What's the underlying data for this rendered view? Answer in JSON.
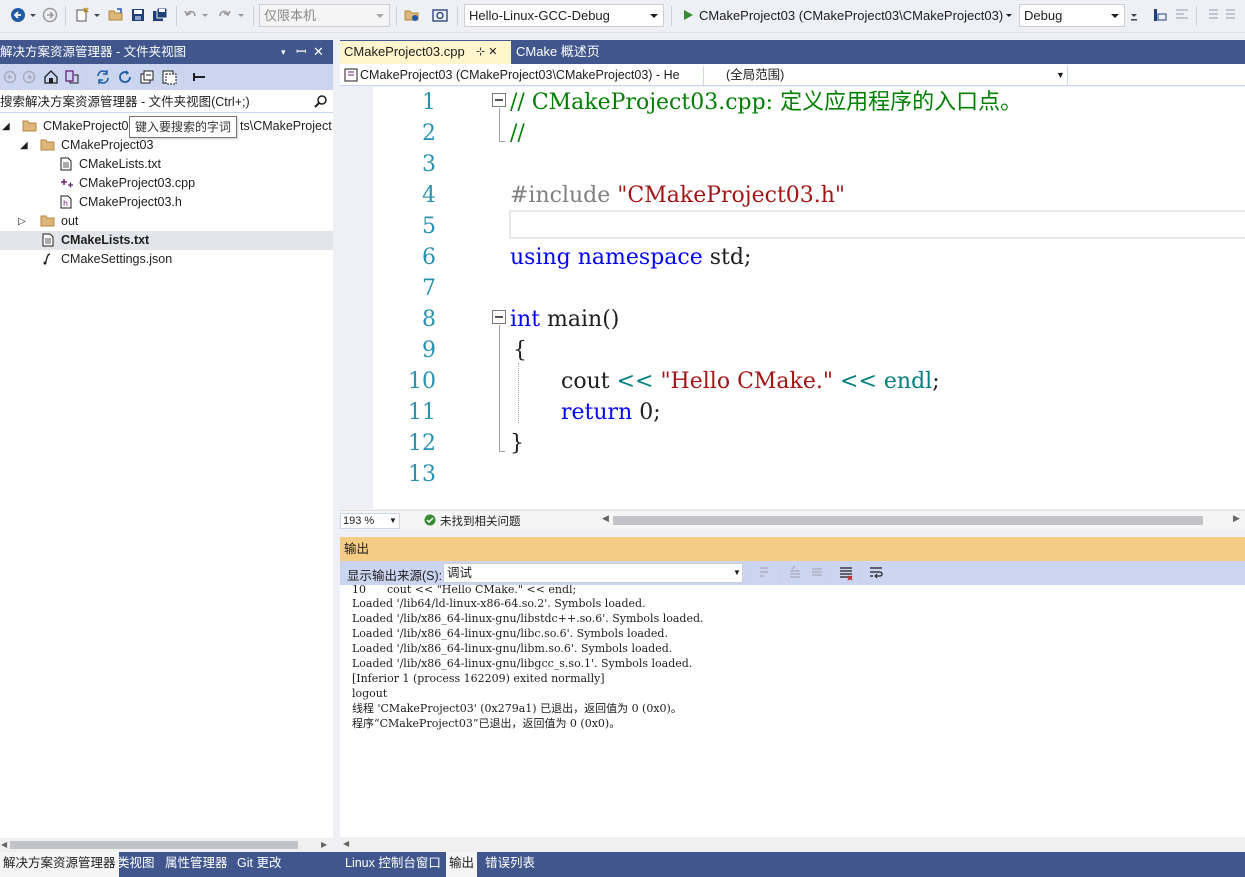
{
  "toolbar": {
    "platform": "仅限本机",
    "config_target": "Hello-Linux-GCC-Debug",
    "startup_item": "CMakeProject03 (CMakeProject03\\CMakeProject03)",
    "build_config": "Debug"
  },
  "left_panel": {
    "title": "解决方案资源管理器 - 文件夹视图",
    "search_placeholder": "搜索解决方案资源管理器 - 文件夹视图(Ctrl+;)",
    "tooltip": "键入要搜索的字词",
    "tree": {
      "root": "CMakeProject0",
      "root_tail": "ts\\CMakeProject",
      "folder": "CMakeProject03",
      "files": [
        "CMakeLists.txt",
        "CMakeProject03.cpp",
        "CMakeProject03.h"
      ],
      "out": "out",
      "root_files": [
        "CMakeLists.txt",
        "CMakeSettings.json"
      ]
    }
  },
  "bottom_tabs": {
    "left": [
      "解决方案资源管理器",
      "类视图",
      "属性管理器",
      "Git 更改"
    ],
    "right": [
      "Linux 控制台窗口",
      "输出",
      "错误列表"
    ]
  },
  "editor": {
    "tabs": [
      "CMakeProject03.cpp",
      "CMake 概述页"
    ],
    "tab_pin": "⊹ ✕",
    "nav_project": "CMakeProject03 (CMakeProject03\\CMakeProject03) - He",
    "nav_scope": "(全局范围)",
    "line_numbers": [
      "1",
      "2",
      "3",
      "4",
      "5",
      "6",
      "7",
      "8",
      "9",
      "10",
      "11",
      "12",
      "13"
    ],
    "code": {
      "l1": "// CMakeProject03.cpp: 定义应用程序的入口点。",
      "l2": "//",
      "l4_pp": "#include ",
      "l4_str": "\"CMakeProject03.h\"",
      "l6_kw1": "using",
      "l6_kw2": "namespace",
      "l6_rest": " std;",
      "l8_kw": "int",
      "l8_rest": " main()",
      "l9": "{",
      "l10_a": "cout",
      "l10_op1": " << ",
      "l10_str": "\"Hello CMake.\"",
      "l10_op2": " << ",
      "l10_b": "endl",
      "l10_c": ";",
      "l11_kw": "return",
      "l11_rest": " 0;",
      "l12": "}"
    },
    "zoom": "193 %",
    "issues": "未找到相关问题"
  },
  "output": {
    "title": "输出",
    "source_label": "显示输出来源(S):",
    "source_value": "调试",
    "lines": [
      "10      cout << \"Hello CMake.\" << endl;",
      "Loaded '/lib64/ld-linux-x86-64.so.2'. Symbols loaded.",
      "Loaded '/lib/x86_64-linux-gnu/libstdc++.so.6'. Symbols loaded.",
      "Loaded '/lib/x86_64-linux-gnu/libc.so.6'. Symbols loaded.",
      "Loaded '/lib/x86_64-linux-gnu/libm.so.6'. Symbols loaded.",
      "Loaded '/lib/x86_64-linux-gnu/libgcc_s.so.1'. Symbols loaded.",
      "[Inferior 1 (process 162209) exited normally]",
      "logout",
      "线程 'CMakeProject03' (0x279a1) 已退出，返回值为 0 (0x0)。",
      "程序“CMakeProject03”已退出，返回值为 0 (0x0)。"
    ]
  },
  "colors": {
    "title_bar": "#40568d",
    "output_title": "#f5cc84",
    "keyword": "#0000ff",
    "comment": "#008000",
    "string": "#a31515",
    "line_number": "#2b91af"
  }
}
